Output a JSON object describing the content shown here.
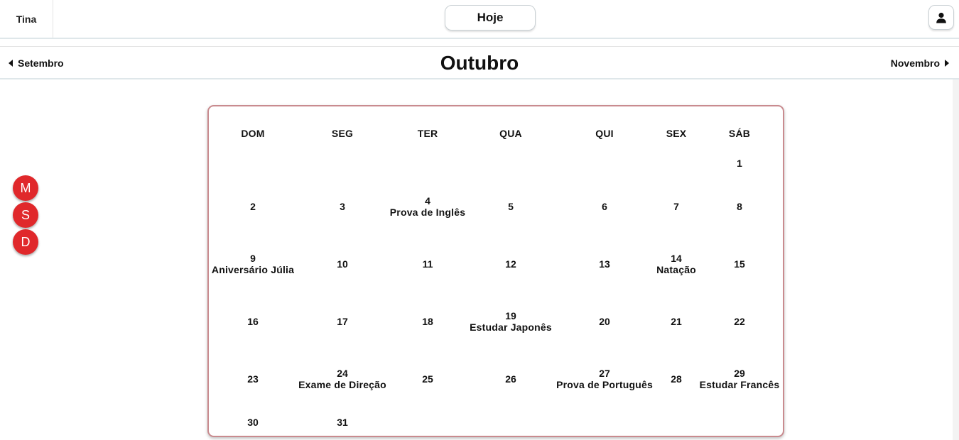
{
  "header": {
    "user_name": "Tina",
    "today_label": "Hoje",
    "profile_icon": "user-icon"
  },
  "month_nav": {
    "prev_label": "Setembro",
    "title": "Outubro",
    "next_label": "Novembro"
  },
  "view_buttons": [
    "M",
    "S",
    "D"
  ],
  "calendar": {
    "weekdays": [
      "DOM",
      "SEG",
      "TER",
      "QUA",
      "QUI",
      "SEX",
      "SÁB"
    ],
    "weeks": [
      [
        null,
        null,
        null,
        null,
        null,
        null,
        {
          "day": "1",
          "event": ""
        }
      ],
      [
        {
          "day": "2",
          "event": ""
        },
        {
          "day": "3",
          "event": ""
        },
        {
          "day": "4",
          "event": "Prova de Inglês"
        },
        {
          "day": "5",
          "event": ""
        },
        {
          "day": "6",
          "event": ""
        },
        {
          "day": "7",
          "event": ""
        },
        {
          "day": "8",
          "event": ""
        }
      ],
      [
        {
          "day": "9",
          "event": "Aniversário Júlia"
        },
        {
          "day": "10",
          "event": ""
        },
        {
          "day": "11",
          "event": ""
        },
        {
          "day": "12",
          "event": ""
        },
        {
          "day": "13",
          "event": ""
        },
        {
          "day": "14",
          "event": "Natação"
        },
        {
          "day": "15",
          "event": ""
        }
      ],
      [
        {
          "day": "16",
          "event": ""
        },
        {
          "day": "17",
          "event": ""
        },
        {
          "day": "18",
          "event": ""
        },
        {
          "day": "19",
          "event": "Estudar Japonês"
        },
        {
          "day": "20",
          "event": ""
        },
        {
          "day": "21",
          "event": ""
        },
        {
          "day": "22",
          "event": ""
        }
      ],
      [
        {
          "day": "23",
          "event": ""
        },
        {
          "day": "24",
          "event": "Exame de Direção"
        },
        {
          "day": "25",
          "event": ""
        },
        {
          "day": "26",
          "event": ""
        },
        {
          "day": "27",
          "event": "Prova de Português"
        },
        {
          "day": "28",
          "event": ""
        },
        {
          "day": "29",
          "event": "Estudar Francês"
        }
      ],
      [
        {
          "day": "30",
          "event": ""
        },
        {
          "day": "31",
          "event": ""
        },
        null,
        null,
        null,
        null,
        null
      ]
    ]
  },
  "colors": {
    "view_button_bg": "#e0282b",
    "calendar_border": "#c98b8f",
    "divider": "#dfe7ea"
  }
}
